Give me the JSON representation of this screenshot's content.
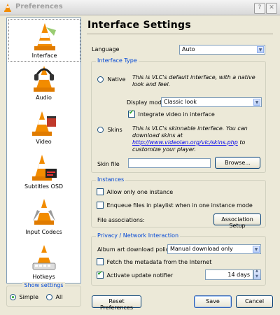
{
  "window": {
    "title": "Preferences"
  },
  "sidebar": {
    "items": [
      {
        "label": "Interface",
        "selected": true
      },
      {
        "label": "Audio"
      },
      {
        "label": "Video"
      },
      {
        "label": "Subtitles OSD"
      },
      {
        "label": "Input  Codecs"
      },
      {
        "label": "Hotkeys"
      }
    ],
    "show_settings": {
      "title": "Show settings",
      "options": [
        "Simple",
        "All"
      ],
      "selected": "Simple"
    }
  },
  "page": {
    "title": "Interface Settings"
  },
  "language": {
    "label": "Language",
    "value": "Auto"
  },
  "interface_type": {
    "title": "Interface Type",
    "native": {
      "label": "Native",
      "selected": false,
      "description": "This is VLC's default interface, with a native look and feel.",
      "display_mode_label": "Display mode",
      "display_mode_value": "Classic look",
      "integrate_video_label": "Integrate video in interface",
      "integrate_video_checked": true
    },
    "skins": {
      "label": "Skins",
      "selected": false,
      "description_prefix": "This is VLC's skinnable interface. You can download skins at ",
      "link": "http://www.videolan.org/vlc/skins.php",
      "description_suffix": " to customize your player.",
      "skin_file_label": "Skin file",
      "skin_file_value": "",
      "browse_label": "Browse..."
    }
  },
  "instances": {
    "title": "Instances",
    "allow_one_label": "Allow only one instance",
    "allow_one_checked": false,
    "enqueue_label": "Enqueue files in playlist when in one instance mode",
    "enqueue_checked": false,
    "file_assoc_label": "File associations:",
    "assoc_button": "Association Setup"
  },
  "privacy": {
    "title": "Privacy / Network Interaction",
    "album_art_label": "Album art download policy",
    "album_art_value": "Manual download only",
    "fetch_meta_label": "Fetch the metadata from the Internet",
    "fetch_meta_checked": false,
    "update_label": "Activate update notifier",
    "update_checked": true,
    "update_days": "14 days"
  },
  "buttons": {
    "reset": "Reset Preferences",
    "save": "Save",
    "cancel": "Cancel"
  },
  "colors": {
    "accent": "#0046d5",
    "cone_orange": "#f28c00",
    "check_green": "#21a121"
  }
}
